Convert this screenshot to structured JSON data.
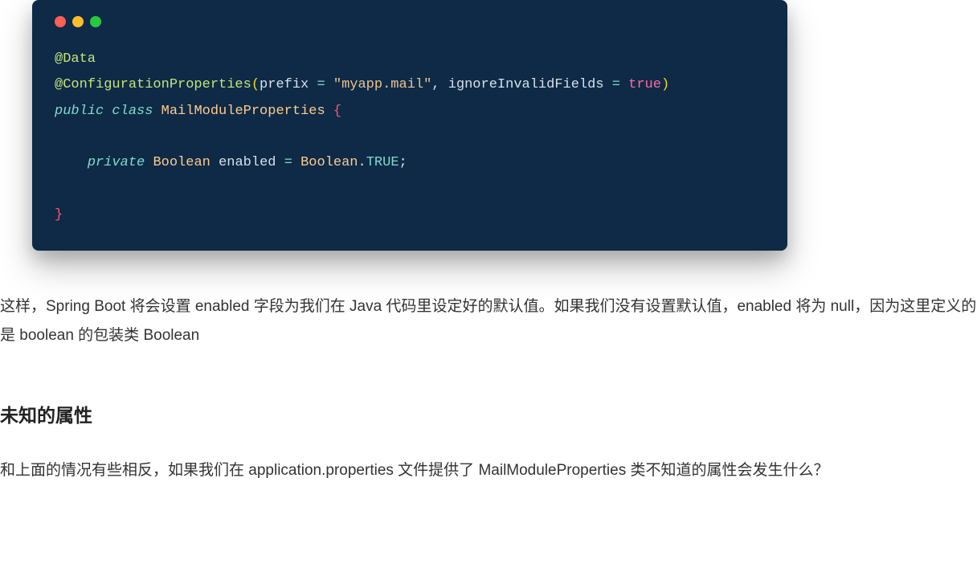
{
  "code": {
    "l1_annot": "@Data",
    "l2_annot": "@ConfigurationProperties",
    "l2_prefix_key": "prefix",
    "l2_prefix_val": "\"myapp.mail\"",
    "l2_ignore_key": "ignoreInvalidFields",
    "l2_ignore_val": "true",
    "l3_public": "public",
    "l3_class": "class",
    "l3_name": "MailModuleProperties",
    "l5_private": "private",
    "l5_type": "Boolean",
    "l5_field": "enabled",
    "l5_rhs_type": "Boolean",
    "l5_rhs_member": "TRUE"
  },
  "article": {
    "p1": "这样，Spring Boot 将会设置 enabled 字段为我们在 Java 代码里设定好的默认值。如果我们没有设置默认值，enabled 将为 null，因为这里定义的是 boolean 的包装类 Boolean",
    "h1": "未知的属性",
    "p2": "和上面的情况有些相反，如果我们在 application.properties 文件提供了 MailModuleProperties 类不知道的属性会发生什么？"
  }
}
